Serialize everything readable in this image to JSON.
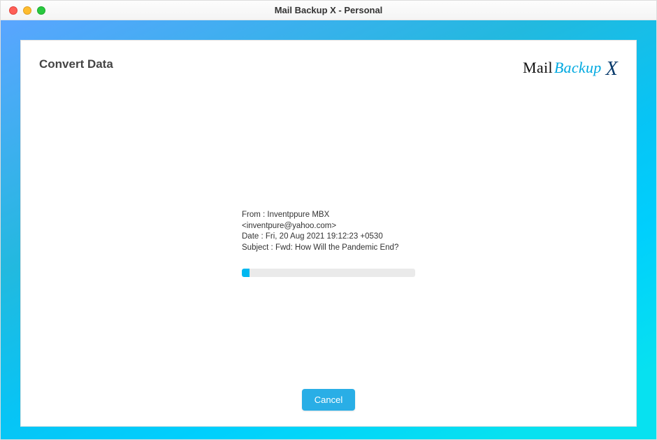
{
  "window": {
    "title": "Mail Backup X - Personal"
  },
  "page": {
    "title": "Convert Data"
  },
  "logo": {
    "mail": "Mail",
    "backup": "Backup",
    "x": "X"
  },
  "current_item": {
    "from_line": "From : Inventppure MBX <inventpure@yahoo.com>",
    "date_line": "Date : Fri, 20 Aug 2021 19:12:23 +0530",
    "subject_line": "Subject : Fwd: How Will the Pandemic End?"
  },
  "progress": {
    "percent": 4.5
  },
  "buttons": {
    "cancel": "Cancel"
  }
}
